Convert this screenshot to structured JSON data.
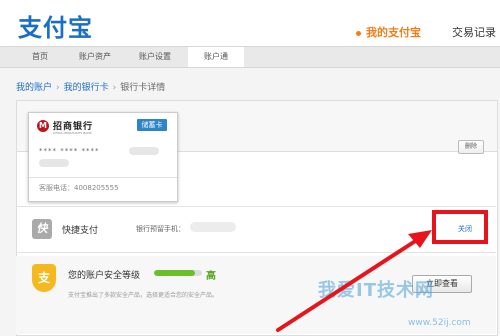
{
  "header": {
    "logo": "支付宝",
    "nav_mine": "我的支付宝",
    "nav_transactions": "交易记录"
  },
  "subnav": {
    "tabs": [
      "首页",
      "账户资产",
      "账户设置",
      "账户通"
    ],
    "active_index": 3
  },
  "breadcrumb": {
    "items": [
      "我的账户",
      "我的银行卡",
      "银行卡详情"
    ]
  },
  "card": {
    "bank_name": "招商银行",
    "bank_name_en": "CHINA MERCHANTS BANK",
    "logo_glyph": "M",
    "type_badge": "储蓄卡",
    "number_masked": "**** **** ****",
    "service_phone": "客服电话：4008205555"
  },
  "delete_button": "删除",
  "quick_pay": {
    "icon_glyph": "快",
    "label": "快捷支付",
    "phone_label": "银行预留手机：",
    "close_link": "关闭"
  },
  "security": {
    "icon_glyph": "支",
    "label": "您的账户安全等级",
    "level": "高",
    "level_fraction": 0.85,
    "description": "支付宝推出了多款安全产品，选择更适合您的安全产品。",
    "view_button": "立即查看"
  },
  "watermark": {
    "text": "我爱IT技术网",
    "url": "www.52ij.com"
  },
  "colors": {
    "brand_blue": "#1a6fc4",
    "accent_orange": "#f07f1a",
    "highlight_red": "#e8141b",
    "progress_green": "#6cbf2b"
  }
}
